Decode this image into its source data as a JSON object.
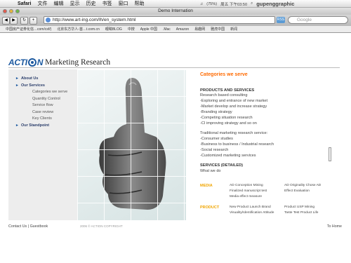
{
  "menubar": {
    "app": "Safari",
    "menus": [
      "文件",
      "编辑",
      "显示",
      "历史",
      "书签",
      "窗口",
      "帮助"
    ],
    "battery": "(75%)",
    "clock": "周五 下午03:50",
    "user": "gupenggraphic"
  },
  "window": {
    "title": "Demo Internation"
  },
  "toolbar": {
    "url": "http://www.art-ing.com/lh/en_system.html",
    "search_placeholder": "Google",
    "rss": "RSS"
  },
  "bookmarks": [
    "中国房产证券化信…com/csf/)",
    "北京东方华人-首…t.com.cn",
    "眼睛BLOG",
    "中搜",
    "Apple 中国",
    ".Mac",
    "Amazon",
    "易趣网",
    "雅虎中国",
    "新闻"
  ],
  "logo": {
    "brand": "ACTI N",
    "tagline": "Marketing Research"
  },
  "nav": [
    {
      "label": "About Us",
      "type": "bold"
    },
    {
      "label": "Our Services",
      "type": "bold"
    },
    {
      "label": "Categories we serve",
      "type": "sub"
    },
    {
      "label": "Quantity Control",
      "type": "sub"
    },
    {
      "label": "Service flow",
      "type": "sub"
    },
    {
      "label": "Case review",
      "type": "sub"
    },
    {
      "label": "Key Clients",
      "type": "sub"
    },
    {
      "label": "Our Standpoint",
      "type": "bold"
    }
  ],
  "content": {
    "heading": "Categories we serve",
    "products_title": "PRODUCTS AND SERVICES",
    "research_based": "Research based consulting",
    "consulting_items": [
      "-Exploring and entrance of new market",
      "-Market develop and increase strategy",
      "-Branding strategy",
      "-Competing situation research",
      "-CI improving strategy and so on"
    ],
    "traditional": "Traditional marketing research service:",
    "traditional_items": [
      "-Consumer studies",
      "-Business to business / Industrial research",
      "-Social research",
      "-Customized marketing services"
    ],
    "detailed_title": "SERVICES (DETAILED)",
    "what_we_do": "What we do"
  },
  "detailed": [
    {
      "label": "MEDIA",
      "col1": [
        "AD Conception Mining",
        "Finalized manuscript test",
        "Media effect measure"
      ],
      "col2": [
        "AD Originality Chose AD",
        "Effect Evaluation",
        ""
      ]
    },
    {
      "label": "PRODUCT",
      "col1": [
        "New Product Launch Brand",
        "Visuality/Identification Attitude"
      ],
      "col2": [
        "Product USP Mining",
        "Taste Test Product Life"
      ]
    }
  ],
  "footer": {
    "contact": "Contact Us",
    "separator": "|",
    "guestbook": "Guestbook",
    "copyright": "2006 © ACTION COPYRIGHT",
    "top": "To Home"
  }
}
